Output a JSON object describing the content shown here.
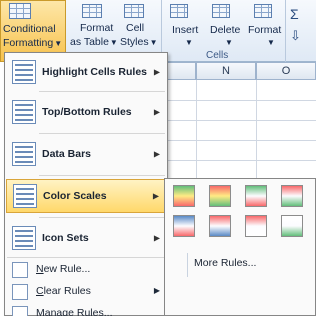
{
  "ribbon": {
    "conditional_formatting": {
      "line1": "Conditional",
      "line2": "Formatting"
    },
    "format_as_table": {
      "line1": "Format",
      "line2": "as Table"
    },
    "cell_styles": {
      "line1": "Cell",
      "line2": "Styles"
    },
    "insert": "Insert",
    "delete": "Delete",
    "format": "Format",
    "cells_group": "Cells"
  },
  "columns": [
    "N",
    "O"
  ],
  "menu": {
    "items": [
      {
        "label": "Highlight Cells Rules",
        "has_submenu": true
      },
      {
        "label": "Top/Bottom Rules",
        "has_submenu": true
      },
      {
        "label": "Data Bars",
        "has_submenu": true
      },
      {
        "label": "Color Scales",
        "has_submenu": true,
        "highlighted": true
      },
      {
        "label": "Icon Sets",
        "has_submenu": true
      }
    ],
    "small_items": [
      {
        "label": "New Rule...",
        "underline_char": "N"
      },
      {
        "label": "Clear Rules",
        "underline_char": "C"
      },
      {
        "label": "Manage Rules...",
        "underline_char": "R"
      }
    ],
    "arrow": "▶"
  },
  "color_scales_submenu": {
    "swatches_row1": [
      [
        "#63be7b",
        "#ffeb84",
        "#f8696b"
      ],
      [
        "#f8696b",
        "#ffeb84",
        "#63be7b"
      ],
      [
        "#63be7b",
        "#fcfcff",
        "#f8696b"
      ],
      [
        "#f8696b",
        "#fcfcff",
        "#63be7b"
      ]
    ],
    "swatches_row2": [
      [
        "#5a8ac6",
        "#fcfcff",
        "#f8696b"
      ],
      [
        "#f8696b",
        "#fcfcff",
        "#5a8ac6"
      ],
      [
        "#f8696b",
        "#fcfcff",
        "#ffffff"
      ],
      [
        "#ffffff",
        "#fcfcff",
        "#63be7b"
      ]
    ],
    "more_rules": "More Rules..."
  }
}
